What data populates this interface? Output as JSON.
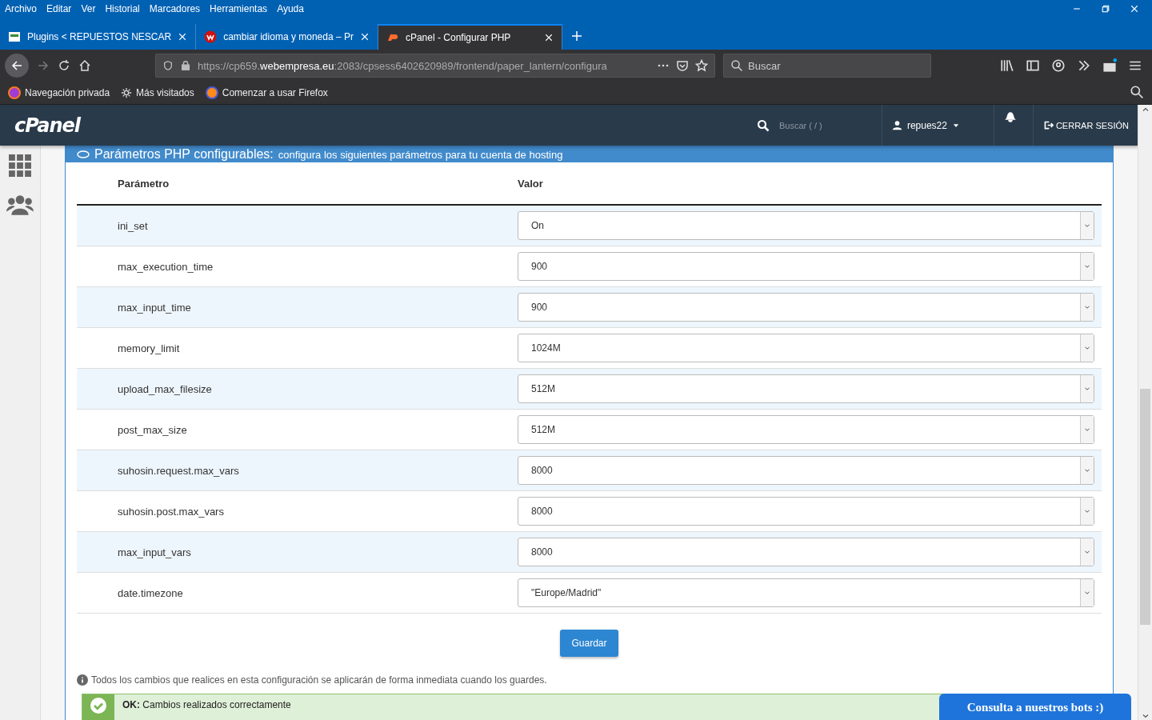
{
  "menu_bar": [
    "Archivo",
    "Editar",
    "Ver",
    "Historial",
    "Marcadores",
    "Herramientas",
    "Ayuda"
  ],
  "tabs": [
    {
      "label": "Plugins < REPUESTOS NESCAR",
      "selected": false
    },
    {
      "label": "cambiar idioma y moneda – Pr",
      "selected": false
    },
    {
      "label": "cPanel - Configurar PHP",
      "selected": true
    }
  ],
  "address_bar": {
    "prefix": "https://cp659.",
    "domain": "webempresa.eu",
    "rest": ":2083/cpsess6402620989/frontend/paper_lantern/configura"
  },
  "browser_search": {
    "placeholder": "Buscar"
  },
  "bookmarks": [
    "Navegación privada",
    "Más visitados",
    "Comenzar a usar Firefox"
  ],
  "cpanel_header": {
    "logo": "cPanel",
    "search_placeholder": "Buscar ( / )",
    "user": "repues22",
    "logout": "CERRAR SESIÓN"
  },
  "panel": {
    "title": "Parámetros PHP configurables:",
    "subtitle": "configura los siguientes parámetros para tu cuenta de hosting"
  },
  "table": {
    "columns": [
      "Parámetro",
      "Valor"
    ],
    "rows": [
      {
        "parameter": "ini_set",
        "value": "On"
      },
      {
        "parameter": "max_execution_time",
        "value": "900"
      },
      {
        "parameter": "max_input_time",
        "value": "900"
      },
      {
        "parameter": "memory_limit",
        "value": "1024M"
      },
      {
        "parameter": "upload_max_filesize",
        "value": "512M"
      },
      {
        "parameter": "post_max_size",
        "value": "512M"
      },
      {
        "parameter": "suhosin.request.max_vars",
        "value": "8000"
      },
      {
        "parameter": "suhosin.post.max_vars",
        "value": "8000"
      },
      {
        "parameter": "max_input_vars",
        "value": "8000"
      },
      {
        "parameter": "date.timezone",
        "value": "\"Europe/Madrid\""
      }
    ]
  },
  "save_button": "Guardar",
  "note": "Todos los cambios que realices en esta configuración se aplicarán de forma inmediata cuando los guardes.",
  "alert": {
    "text": "**OK:** Cambios realizados correctamente"
  },
  "chat_button": "Consulta a nuestros bots :)"
}
